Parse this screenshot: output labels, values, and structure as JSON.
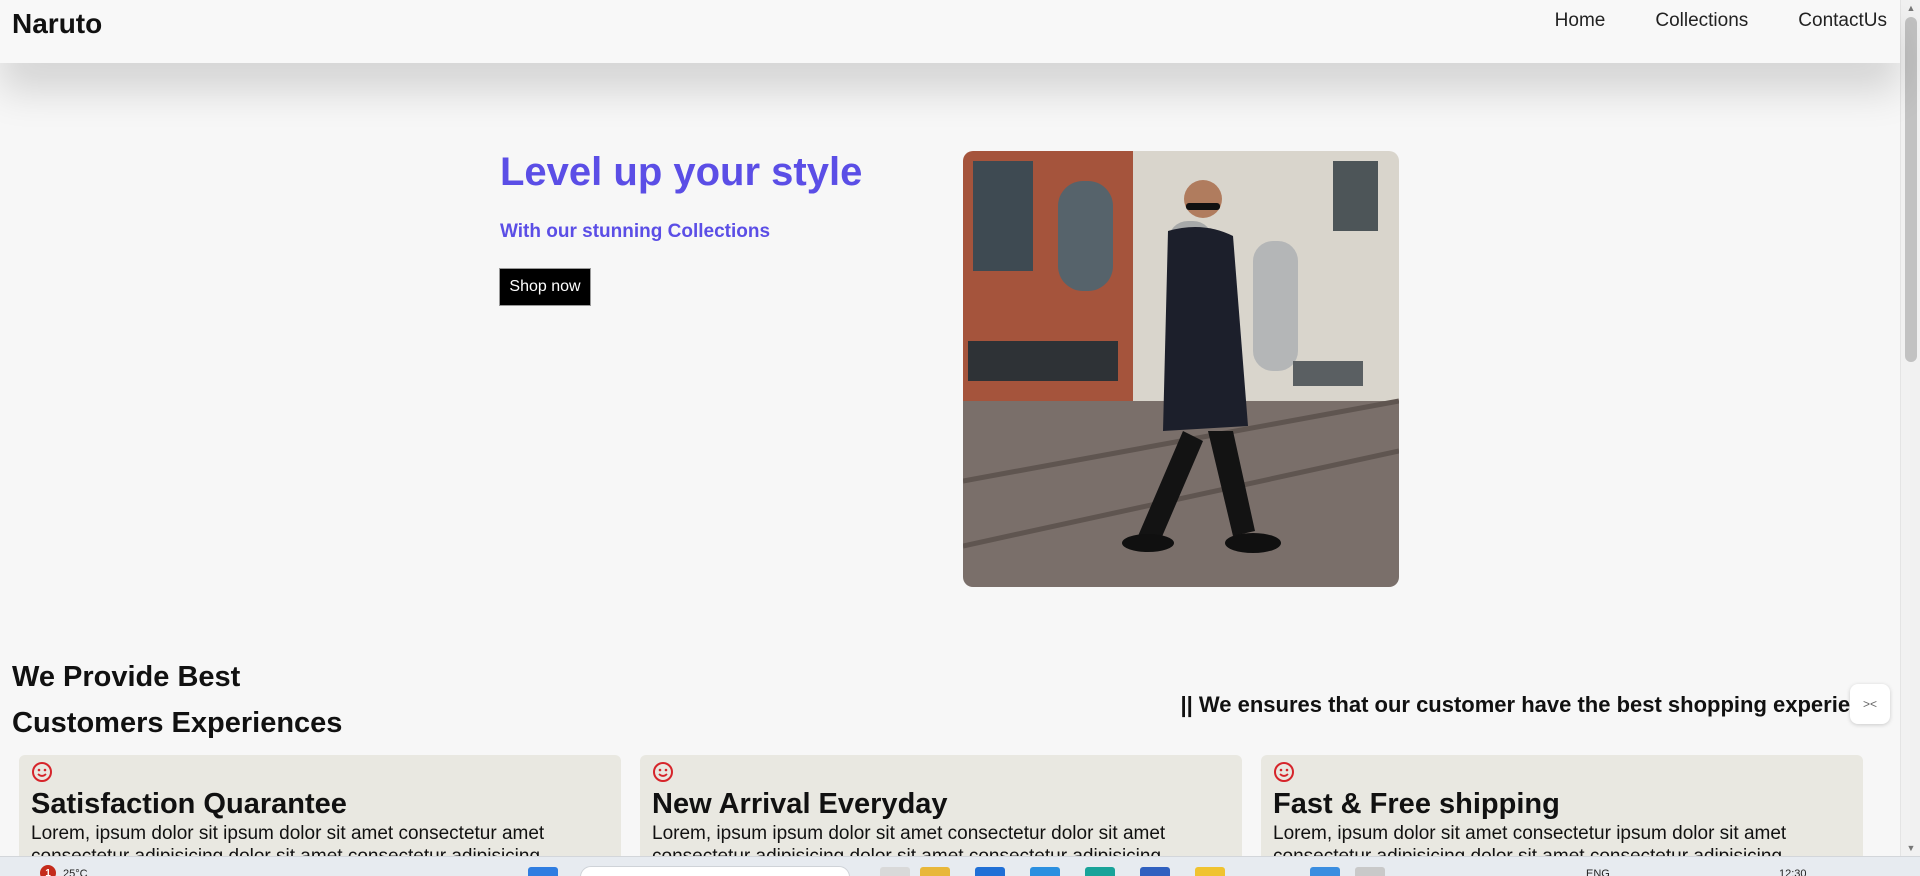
{
  "header": {
    "logo": "Naruto",
    "nav": [
      "Home",
      "Collections",
      "ContactUs"
    ]
  },
  "hero": {
    "title": "Level up your style",
    "subtitle": "With our stunning Collections",
    "button": "Shop now"
  },
  "experience": {
    "heading_line1": "We Provide Best",
    "heading_line2": "Customers Experiences",
    "tagline": "|| We ensures that our customer have the best shopping experience"
  },
  "features": [
    {
      "title": "Satisfaction Quarantee",
      "text": "Lorem, ipsum dolor sit ipsum dolor sit amet consectetur amet consectetur adipisicing dolor sit amet consectetur adipisicing"
    },
    {
      "title": "New Arrival Everyday",
      "text": "Lorem, ipsum ipsum dolor sit amet consectetur dolor sit amet consectetur adipisicing dolor sit amet consectetur adipisicing"
    },
    {
      "title": "Fast & Free shipping",
      "text": "Lorem, ipsum dolor sit amet consectetur ipsum dolor sit amet consectetur adipisicing dolor sit amet consectetur adipisicing"
    }
  ],
  "taskbar": {
    "weather_badge": "1",
    "temperature": "25°C",
    "language": "ENG",
    "clock": "12:30"
  },
  "colors": {
    "accent": "#5b4ee6",
    "card_bg": "#e9e8e1",
    "icon_red": "#d6242a"
  },
  "icons": {
    "feature_icon": "smile-icon",
    "float_icon": "collapse-icon"
  }
}
